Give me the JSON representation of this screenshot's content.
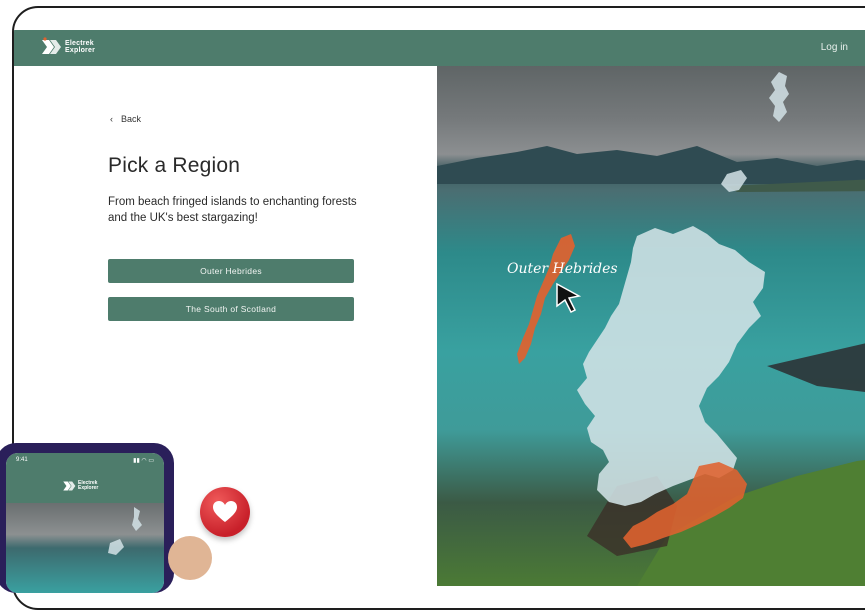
{
  "brand": {
    "name_line1": "Electrek",
    "name_line2": "Explorer"
  },
  "nav": {
    "login_label": "Log in"
  },
  "back": {
    "label": "Back"
  },
  "main": {
    "title": "Pick a Region",
    "subtitle": "From beach fringed islands to enchanting forests and the UK's best stargazing!"
  },
  "regions": [
    {
      "label": "Outer Hebrides"
    },
    {
      "label": "The South of Scotland"
    }
  ],
  "map": {
    "hover_label": "Outer Hebrides"
  },
  "phone": {
    "time": "9:41",
    "brand_line1": "Electrek",
    "brand_line2": "Explorer"
  },
  "colors": {
    "brand_green": "#4e7c6c",
    "highlight_orange": "#e0622f",
    "map_fill": "#d2e2e6"
  }
}
